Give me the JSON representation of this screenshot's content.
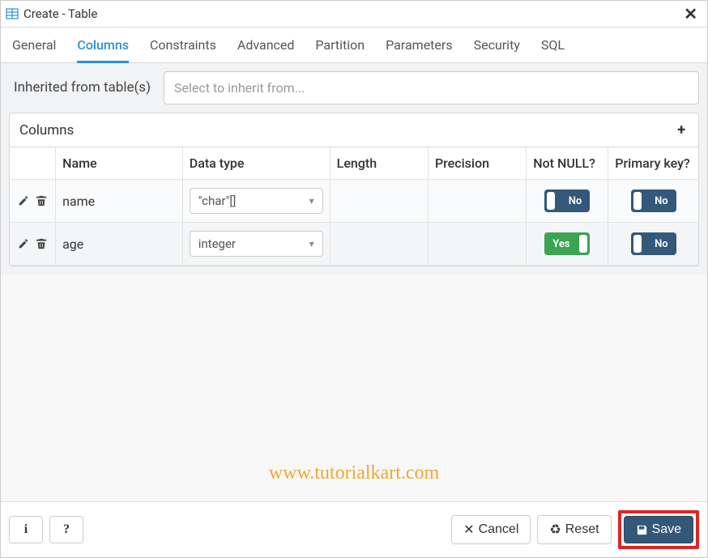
{
  "window": {
    "title": "Create - Table"
  },
  "tabs": [
    "General",
    "Columns",
    "Constraints",
    "Advanced",
    "Partition",
    "Parameters",
    "Security",
    "SQL"
  ],
  "active_tab": "Columns",
  "inherit": {
    "label": "Inherited from table(s)",
    "placeholder": "Select to inherit from..."
  },
  "columns_panel": {
    "title": "Columns",
    "headers": [
      "",
      "Name",
      "Data type",
      "Length",
      "Precision",
      "Not NULL?",
      "Primary key?"
    ],
    "rows": [
      {
        "name": "name",
        "type": "\"char\"[]",
        "length": "",
        "precision": "",
        "not_null": "No",
        "pk": "No"
      },
      {
        "name": "age",
        "type": "integer",
        "length": "",
        "precision": "",
        "not_null": "Yes",
        "pk": "No"
      }
    ]
  },
  "footer": {
    "info": "i",
    "help": "?",
    "cancel": "Cancel",
    "reset": "Reset",
    "save": "Save"
  },
  "watermark": "www.tutorialkart.com"
}
